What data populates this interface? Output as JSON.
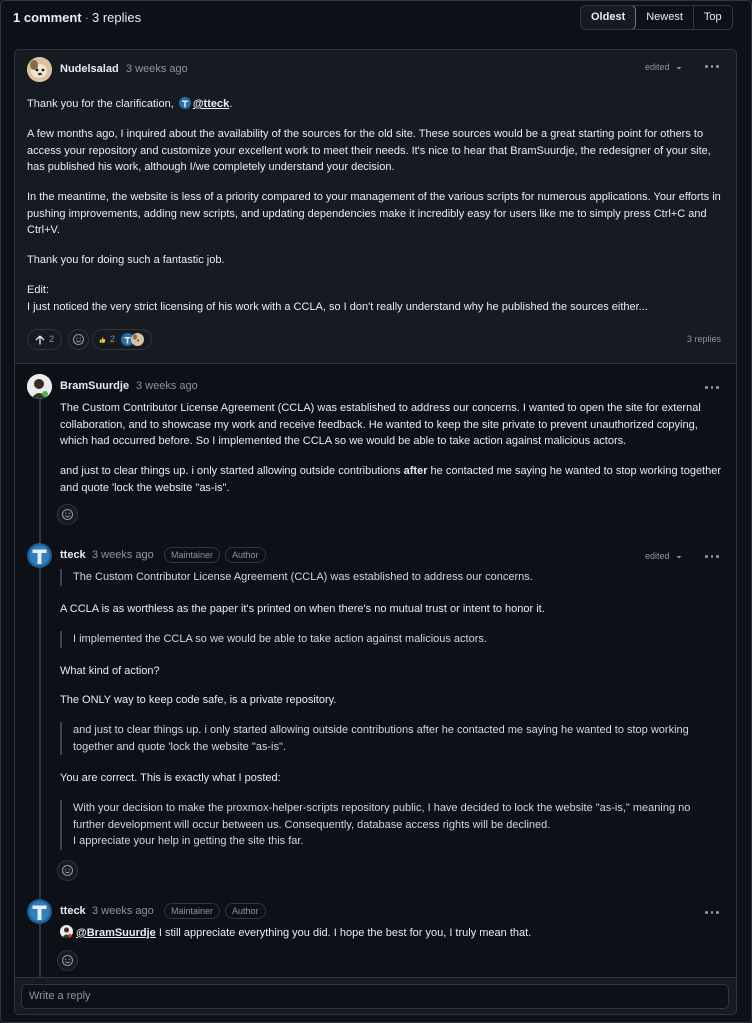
{
  "header": {
    "comment_count": "1 comment",
    "reply_count": "3 replies",
    "sort": [
      "Oldest",
      "Newest",
      "Top"
    ]
  },
  "main_comment": {
    "author": "Nudelsalad",
    "time": "3 weeks ago",
    "edited": "edited",
    "p1_text": "Thank you for the clarification,",
    "p1_mention": "@tteck",
    "p2": "A few months ago, I inquired about the availability of the sources for the old site. These sources would be a great starting point for others to access your repository and customize your excellent work to meet their needs. It's nice to hear that BramSuurdje, the redesigner of your site, has published his work, although I/we completely understand your decision.",
    "p3": "In the meantime, the website is less of a priority compared to your management of the various scripts for numerous applications. Your efforts in pushing improvements, adding new scripts, and updating dependencies make it incredibly easy for users like me to simply press Ctrl+C and Ctrl+V.",
    "p4": "Thank you for doing such a fantastic job.",
    "p5_line1": "Edit:",
    "p5_line2": "I just noticed the very strict licensing of his work with a CCLA, so I don't really understand why he published the sources either...",
    "upvotes": "2",
    "thumbs": "2",
    "replies_label": "3 replies"
  },
  "reply1": {
    "author": "BramSuurdje",
    "time": "3 weeks ago",
    "p1": "The Custom Contributor License Agreement (CCLA) was established to address our concerns. I wanted to open the site for external collaboration, and to showcase my work and receive feedback. He wanted to keep the site private to prevent unauthorized copying, which had occurred before. So I implemented the CCLA so we would be able to take action against malicious actors.",
    "p2_before": "and just to clear things up. i only started allowing outside contributions ",
    "p2_bold": "after",
    "p2_after": " he contacted me saying he wanted to stop working together and quote 'lock the website \"as-is\"."
  },
  "reply2": {
    "author": "tteck",
    "time": "3 weeks ago",
    "badge1": "Maintainer",
    "badge2": "Author",
    "edited": "edited",
    "q1": "The Custom Contributor License Agreement (CCLA) was established to address our concerns.",
    "t1": "A CCLA is as worthless as the paper it's printed on when there's no mutual trust or intent to honor it.",
    "q2": "I implemented the CCLA so we would be able to take action against malicious actors.",
    "t2": "What kind of action?",
    "t3": "The ONLY way to keep code safe, is a private repository.",
    "q3": "and just to clear things up. i only started allowing outside contributions after he contacted me saying he wanted to stop working together and quote 'lock the website \"as-is\".",
    "t4": "You are correct. This is exactly what I posted:",
    "q4_line1": "With your decision to make the proxmox-helper-scripts repository public, I have decided to lock the website \"as-is,\" meaning no further development will occur between us. Consequently, database access rights will be declined.",
    "q4_line2": "I appreciate your help in getting the site this far."
  },
  "reply3": {
    "author": "tteck",
    "time": "3 weeks ago",
    "badge1": "Maintainer",
    "badge2": "Author",
    "mention": "@BramSuurdje",
    "text": " I still appreciate everything you did. I hope the best for you, I truly mean that."
  },
  "reply_box": {
    "placeholder": "Write a reply"
  },
  "colors": {
    "background": "#0d1117",
    "card": "#161b22",
    "border": "#30363d",
    "text": "#e6edf3",
    "muted": "#8b949e"
  }
}
